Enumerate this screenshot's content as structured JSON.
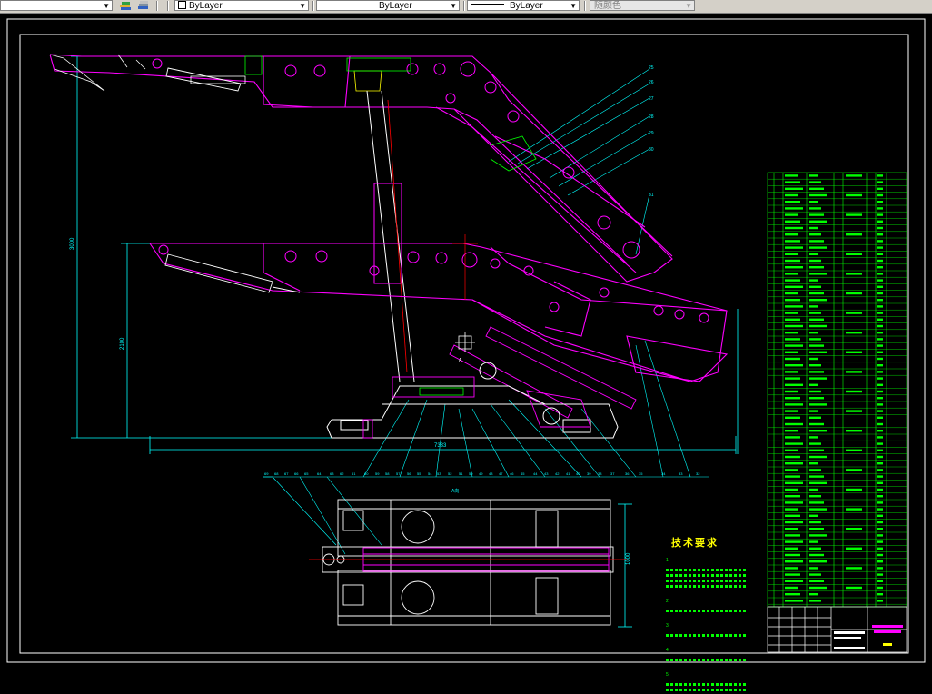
{
  "toolbar": {
    "layer_combo": "ByLayer",
    "linetype_combo": "ByLayer",
    "lineweight_combo": "ByLayer",
    "color_combo": "随颜色"
  },
  "dimensions": {
    "overall_height": "3000",
    "mid_height": "2100",
    "overall_length": "7333",
    "plan_width": "1000"
  },
  "view_label": "A",
  "section_label": "A向",
  "part_callouts_top": [
    "25",
    "26",
    "27",
    "28",
    "29",
    "30",
    "31"
  ],
  "part_callouts_bottom": [
    "69",
    "68",
    "67",
    "66",
    "65",
    "64",
    "63",
    "62",
    "61",
    "60",
    "59",
    "58",
    "57",
    "56",
    "55",
    "54",
    "53",
    "52",
    "51",
    "50",
    "49",
    "48",
    "47",
    "46",
    "45",
    "44",
    "43",
    "42",
    "41",
    "40",
    "39",
    "38",
    "37",
    "36",
    "35",
    "34",
    "33",
    "32"
  ],
  "tech_requirements": {
    "title": "技术要求",
    "items": [
      "1.",
      "2.",
      "3.",
      "4.",
      "5."
    ]
  },
  "colors": {
    "frame": "#ffffff",
    "structure": "#ff00ff",
    "dimension": "#00ffff",
    "detail": "#ffffff",
    "bom": "#00ff00",
    "center_line": "#ff0000",
    "title_text": "#ffff00"
  }
}
